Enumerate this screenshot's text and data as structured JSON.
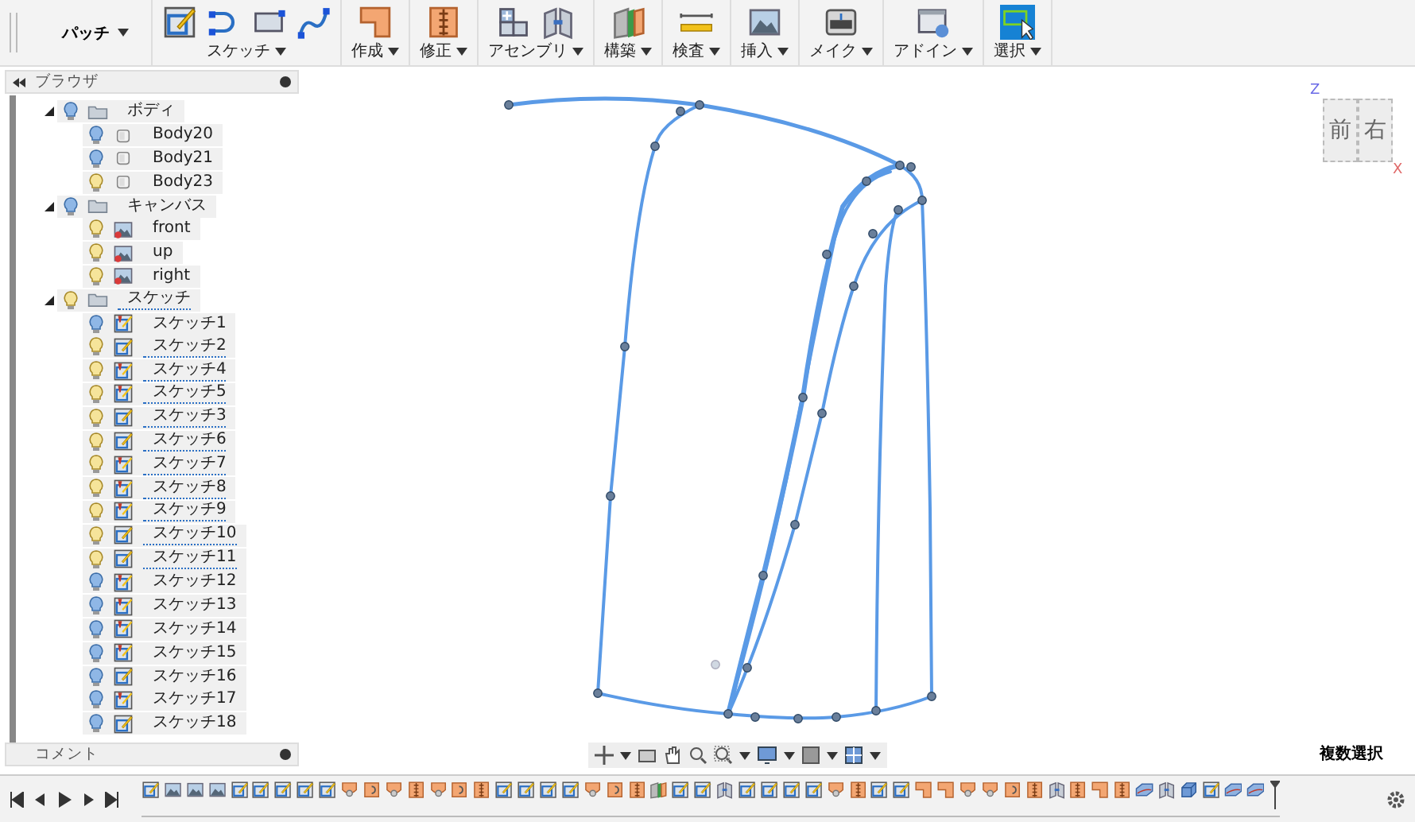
{
  "toolbar": {
    "workspace": "パッチ",
    "groups": [
      {
        "label": "スケッチ",
        "tools": [
          {
            "kind": "sketch"
          },
          {
            "kind": "arc"
          },
          {
            "kind": "rect"
          },
          {
            "kind": "spline"
          }
        ],
        "selected": false
      },
      {
        "label": "作成",
        "tools": [
          {
            "kind": "corner"
          }
        ],
        "selected": false
      },
      {
        "label": "修正",
        "tools": [
          {
            "kind": "zipper"
          }
        ],
        "selected": false
      },
      {
        "label": "アセンブリ",
        "tools": [
          {
            "kind": "cubes"
          },
          {
            "kind": "link"
          }
        ],
        "selected": false
      },
      {
        "label": "構築",
        "tools": [
          {
            "kind": "panels"
          }
        ],
        "selected": false
      },
      {
        "label": "検査",
        "tools": [
          {
            "kind": "ruler"
          }
        ],
        "selected": false
      },
      {
        "label": "挿入",
        "tools": [
          {
            "kind": "picture"
          }
        ],
        "selected": false
      },
      {
        "label": "メイク",
        "tools": [
          {
            "kind": "printer"
          }
        ],
        "selected": false
      },
      {
        "label": "アドイン",
        "tools": [
          {
            "kind": "addin"
          }
        ],
        "selected": false
      },
      {
        "label": "選択",
        "tools": [
          {
            "kind": "select"
          }
        ],
        "selected": true
      }
    ]
  },
  "browser": {
    "title": "ブラウザ",
    "tree": [
      {
        "label": "ボディ",
        "kind": "folder",
        "visible": true,
        "expanded": true,
        "flagged": false,
        "children": [
          {
            "label": "Body20",
            "kind": "body",
            "visible": true,
            "flagged": false
          },
          {
            "label": "Body21",
            "kind": "body",
            "visible": true,
            "flagged": false
          },
          {
            "label": "Body23",
            "kind": "body",
            "visible": false,
            "flagged": false
          }
        ]
      },
      {
        "label": "キャンバス",
        "kind": "folder",
        "visible": true,
        "expanded": true,
        "flagged": false,
        "children": [
          {
            "label": "front",
            "kind": "canvas",
            "visible": false,
            "flagged": false
          },
          {
            "label": "up",
            "kind": "canvas",
            "visible": false,
            "flagged": false
          },
          {
            "label": "right",
            "kind": "canvas",
            "visible": false,
            "flagged": false
          }
        ]
      },
      {
        "label": "スケッチ",
        "kind": "folder",
        "visible": false,
        "expanded": true,
        "flagged": true,
        "children": [
          {
            "label": "スケッチ1",
            "kind": "sketchpin",
            "visible": true,
            "flagged": false
          },
          {
            "label": "スケッチ2",
            "kind": "sketch",
            "visible": false,
            "flagged": true
          },
          {
            "label": "スケッチ4",
            "kind": "sketchpin",
            "visible": false,
            "flagged": true
          },
          {
            "label": "スケッチ5",
            "kind": "sketchpin",
            "visible": false,
            "flagged": true
          },
          {
            "label": "スケッチ3",
            "kind": "sketch",
            "visible": false,
            "flagged": true
          },
          {
            "label": "スケッチ6",
            "kind": "sketch",
            "visible": false,
            "flagged": true
          },
          {
            "label": "スケッチ7",
            "kind": "sketchpin",
            "visible": false,
            "flagged": true
          },
          {
            "label": "スケッチ8",
            "kind": "sketchpin",
            "visible": false,
            "flagged": true
          },
          {
            "label": "スケッチ9",
            "kind": "sketchpin",
            "visible": false,
            "flagged": true
          },
          {
            "label": "スケッチ10",
            "kind": "sketch",
            "visible": false,
            "flagged": true
          },
          {
            "label": "スケッチ11",
            "kind": "sketch",
            "visible": false,
            "flagged": true
          },
          {
            "label": "スケッチ12",
            "kind": "sketchpin",
            "visible": true,
            "flagged": false
          },
          {
            "label": "スケッチ13",
            "kind": "sketchpin",
            "visible": true,
            "flagged": false
          },
          {
            "label": "スケッチ14",
            "kind": "sketchpin",
            "visible": true,
            "flagged": false
          },
          {
            "label": "スケッチ15",
            "kind": "sketchpin",
            "visible": true,
            "flagged": false
          },
          {
            "label": "スケッチ16",
            "kind": "sketch",
            "visible": true,
            "flagged": false
          },
          {
            "label": "スケッチ17",
            "kind": "sketchpin",
            "visible": true,
            "flagged": false
          },
          {
            "label": "スケッチ18",
            "kind": "sketch",
            "visible": true,
            "flagged": false
          }
        ]
      }
    ]
  },
  "comments": {
    "title": "コメント"
  },
  "viewcube": {
    "front": "前",
    "right": "右",
    "z_axis": "Z",
    "x_axis": "X"
  },
  "status": "複数選択",
  "timeline": {
    "items": [
      {
        "kind": "sketch"
      },
      {
        "kind": "picture"
      },
      {
        "kind": "picture"
      },
      {
        "kind": "picture"
      },
      {
        "kind": "sketch"
      },
      {
        "kind": "sketch"
      },
      {
        "kind": "sketch"
      },
      {
        "kind": "sketch"
      },
      {
        "kind": "sketch"
      },
      {
        "kind": "cup"
      },
      {
        "kind": "rotate"
      },
      {
        "kind": "cup"
      },
      {
        "kind": "zipper"
      },
      {
        "kind": "cup"
      },
      {
        "kind": "rotate"
      },
      {
        "kind": "zipper"
      },
      {
        "kind": "sketch"
      },
      {
        "kind": "sketch"
      },
      {
        "kind": "sketch"
      },
      {
        "kind": "sketch"
      },
      {
        "kind": "cup"
      },
      {
        "kind": "rotate"
      },
      {
        "kind": "zipper"
      },
      {
        "kind": "panels"
      },
      {
        "kind": "sketch"
      },
      {
        "kind": "sketch"
      },
      {
        "kind": "link"
      },
      {
        "kind": "sketch"
      },
      {
        "kind": "sketch"
      },
      {
        "kind": "sketch"
      },
      {
        "kind": "sketch"
      },
      {
        "kind": "cup"
      },
      {
        "kind": "zipper"
      },
      {
        "kind": "sketch"
      },
      {
        "kind": "sketch"
      },
      {
        "kind": "corner"
      },
      {
        "kind": "corner"
      },
      {
        "kind": "cup"
      },
      {
        "kind": "cup"
      },
      {
        "kind": "rotate"
      },
      {
        "kind": "zipper"
      },
      {
        "kind": "link"
      },
      {
        "kind": "zipper"
      },
      {
        "kind": "corner"
      },
      {
        "kind": "zipper"
      },
      {
        "kind": "slab"
      },
      {
        "kind": "link"
      },
      {
        "kind": "cube"
      },
      {
        "kind": "sketch"
      },
      {
        "kind": "slab"
      },
      {
        "kind": "slab"
      }
    ]
  }
}
